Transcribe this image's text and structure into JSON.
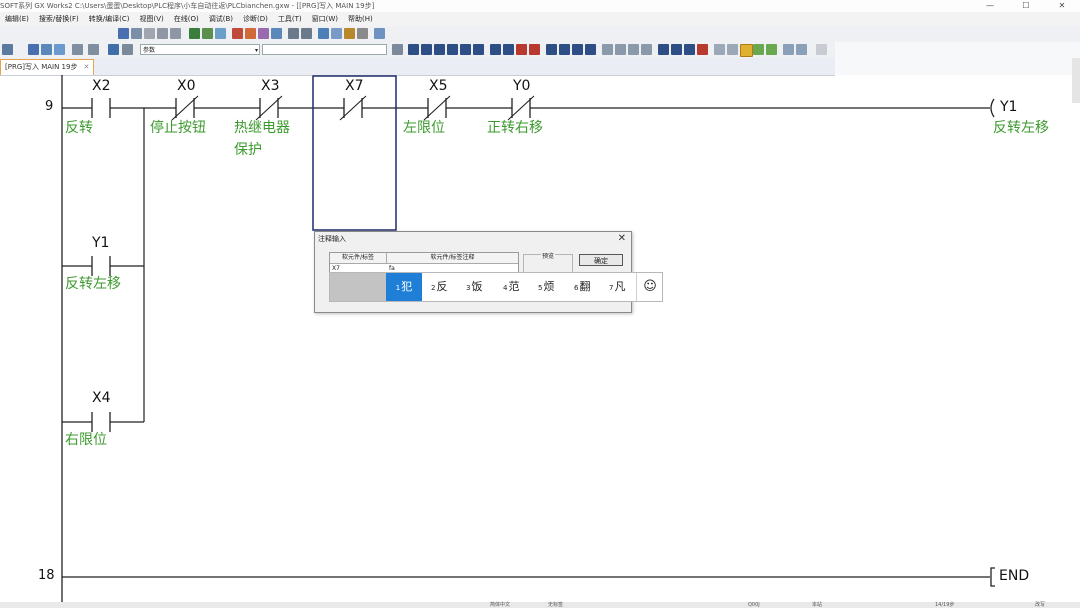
{
  "window": {
    "title": "SOFT系列 GX Works2 C:\\Users\\蛋蛋\\Desktop\\PLC程序\\小车自动往返\\PLCbianchen.gxw - [[PRG]写入 MAIN 19步]",
    "btn_min": "—",
    "btn_max": "☐",
    "btn_close": "✕"
  },
  "menu": [
    "编辑(E)",
    "搜索/替换(F)",
    "转换/编译(C)",
    "视图(V)",
    "在线(O)",
    "调试(B)",
    "诊断(D)",
    "工具(T)",
    "窗口(W)",
    "帮助(H)"
  ],
  "toolbar": {
    "param_combo": "参数",
    "combo_arrow": "▾"
  },
  "tab": {
    "label": "[PRG]写入 MAIN 19步",
    "close": "✕"
  },
  "ladder": {
    "rungs": [
      {
        "step": "9"
      },
      {
        "step": "18"
      }
    ],
    "contacts": [
      {
        "device": "X2",
        "comment": "反转"
      },
      {
        "device": "X0",
        "comment": "停止按钮"
      },
      {
        "device": "X3",
        "comment": "热继电器",
        "comment2": "保护"
      },
      {
        "device": "X7",
        "comment": ""
      },
      {
        "device": "X5",
        "comment": "左限位"
      },
      {
        "device": "Y0",
        "comment": "正转右移"
      },
      {
        "device": "Y1",
        "comment": "反转左移"
      },
      {
        "device": "X4",
        "comment": "右限位"
      }
    ],
    "coil": {
      "device": "Y1",
      "comment": "反转左移"
    },
    "end_label": "END"
  },
  "dialog": {
    "title": "注释输入",
    "close": "✕",
    "col_device": "软元件/标签",
    "col_comment": "软元件/标签注释",
    "device_value": "X7",
    "comment_value": "fa",
    "preview_label": "预览",
    "ok_label": "确定"
  },
  "ime": {
    "candidates": [
      {
        "num": "1",
        "text": "犯"
      },
      {
        "num": "2",
        "text": "反"
      },
      {
        "num": "3",
        "text": "饭"
      },
      {
        "num": "4",
        "text": "范"
      },
      {
        "num": "5",
        "text": "烦"
      },
      {
        "num": "6",
        "text": "翻"
      },
      {
        "num": "7",
        "text": "凡"
      }
    ],
    "selected_index": 0,
    "emoji": "☺"
  },
  "statusbar": {
    "s1": "简体中文",
    "s2": "无标签",
    "s3": "Q00J",
    "s4": "本站",
    "s5": "14/19步",
    "s6": "改写"
  },
  "colors": {
    "comment_green": "#3c9a2e",
    "selected_cell": "#1f2a6b",
    "ime_selected": "#1f7fd6",
    "tab_border": "#e9a34a"
  }
}
